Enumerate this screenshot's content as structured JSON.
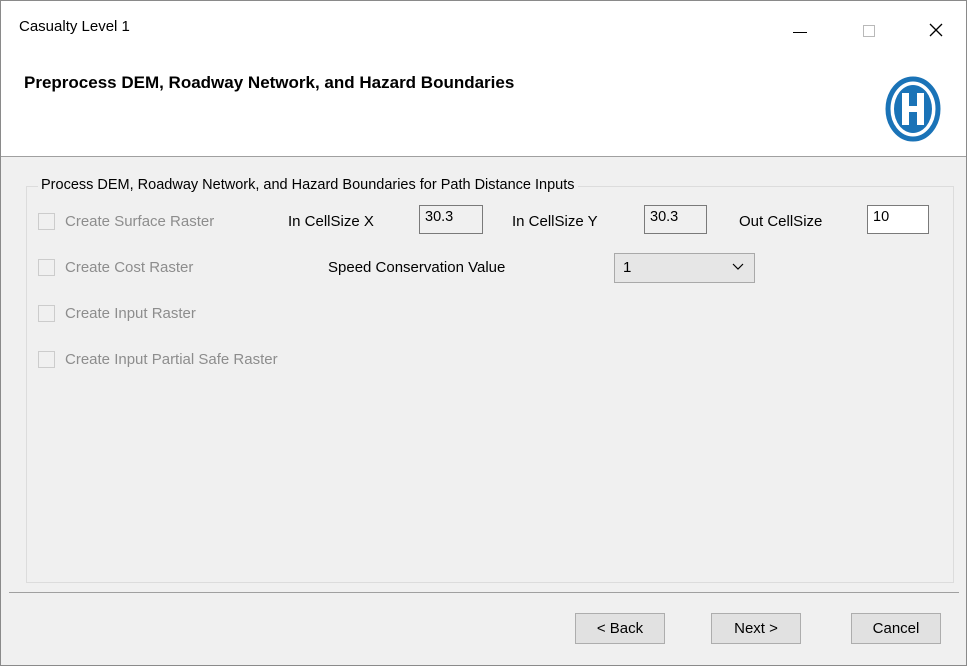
{
  "window": {
    "title": "Casualty Level 1"
  },
  "header": {
    "title": "Preprocess DEM, Roadway Network, and Hazard Boundaries",
    "logo_icon": "h-circle-logo",
    "logo_color": "#1a73b7"
  },
  "group": {
    "legend": "Process DEM, Roadway Network, and Hazard Boundaries for Path Distance Inputs",
    "checkboxes": [
      {
        "label": "Create Surface Raster",
        "checked": false,
        "enabled": false
      },
      {
        "label": "Create Cost Raster",
        "checked": false,
        "enabled": false
      },
      {
        "label": "Create Input Raster",
        "checked": false,
        "enabled": false
      },
      {
        "label": "Create Input Partial Safe Raster",
        "checked": false,
        "enabled": false
      }
    ],
    "in_cellsize_x": {
      "label": "In CellSize X",
      "value": "30.3"
    },
    "in_cellsize_y": {
      "label": "In CellSize Y",
      "value": "30.3"
    },
    "out_cellsize": {
      "label": "Out CellSize",
      "value": "10"
    },
    "speed_conservation": {
      "label": "Speed Conservation Value",
      "selected": "1"
    }
  },
  "buttons": {
    "back": "< Back",
    "next": "Next >",
    "cancel": "Cancel"
  }
}
